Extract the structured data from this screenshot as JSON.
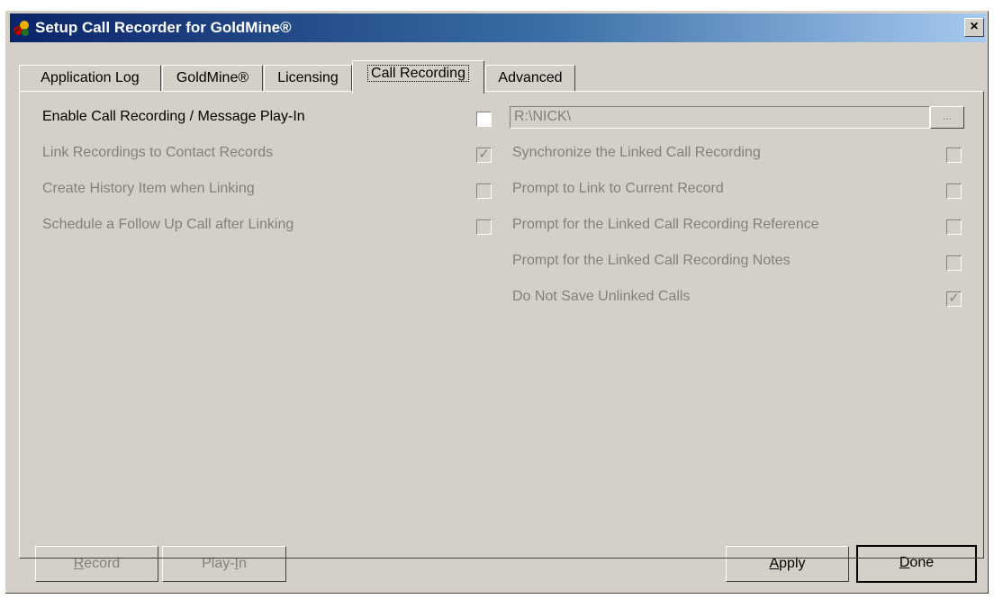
{
  "window": {
    "title": "Setup Call Recorder for GoldMine®",
    "close_label": "×"
  },
  "tabs": [
    {
      "label": "Application Log"
    },
    {
      "label": "GoldMine®"
    },
    {
      "label": "Licensing"
    },
    {
      "label": "Call Recording",
      "active": true
    },
    {
      "label": "Advanced"
    }
  ],
  "left_options": [
    {
      "label": "Enable Call Recording / Message Play-In",
      "checked": false,
      "enabled": true
    },
    {
      "label": "Link Recordings to Contact Records",
      "checked": true,
      "enabled": false
    },
    {
      "label": "Create History Item when Linking",
      "checked": false,
      "enabled": false
    },
    {
      "label": "Schedule a Follow Up Call after Linking",
      "checked": false,
      "enabled": false
    }
  ],
  "path": {
    "value": "R:\\NICK\\",
    "browse_label": "..."
  },
  "right_options": [
    {
      "label": "Synchronize the Linked Call Recording",
      "checked": false,
      "enabled": false
    },
    {
      "label": "Prompt to Link to Current Record",
      "checked": false,
      "enabled": false
    },
    {
      "label": "Prompt for the Linked Call Recording Reference",
      "checked": false,
      "enabled": false
    },
    {
      "label": "Prompt for the Linked Call Recording Notes",
      "checked": false,
      "enabled": false
    },
    {
      "label": "Do Not Save Unlinked Calls",
      "checked": true,
      "enabled": false
    }
  ],
  "buttons": {
    "record": {
      "first": "R",
      "rest": "ecord",
      "enabled": false
    },
    "playin": {
      "first": "Play-",
      "under": "I",
      "rest": "n",
      "enabled": false
    },
    "apply": {
      "first": "A",
      "rest": "pply",
      "enabled": true
    },
    "done": {
      "first": "D",
      "rest": "one",
      "enabled": true
    }
  },
  "colors": {
    "face": "#d4d0c8",
    "title_start": "#0a246a",
    "title_end": "#a6caf0",
    "disabled_text": "#808080"
  }
}
